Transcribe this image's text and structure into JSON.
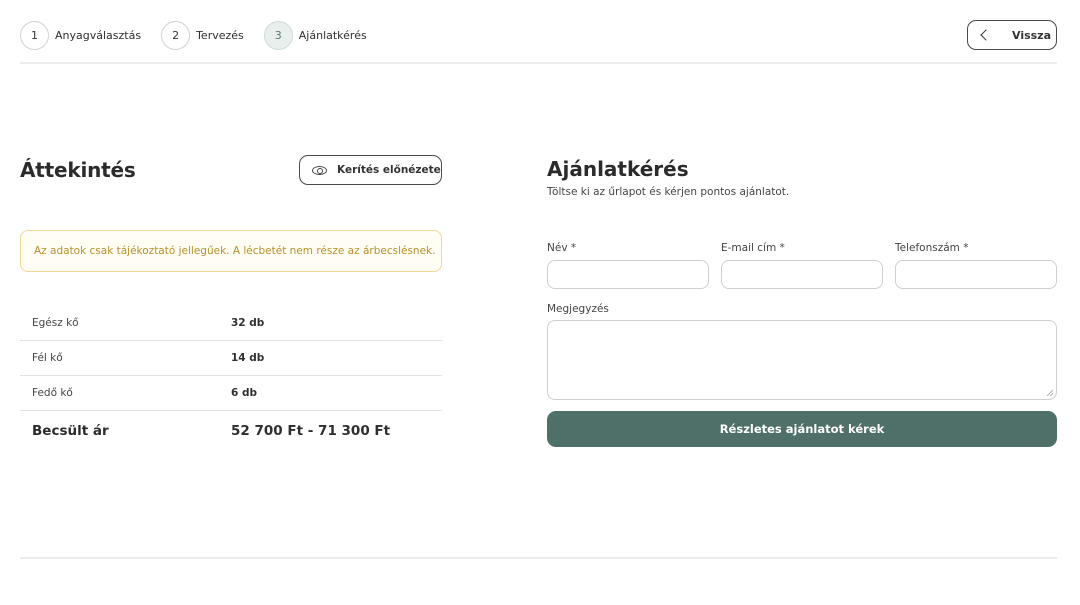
{
  "steps": [
    {
      "number": "1",
      "label": "Anyagválasztás"
    },
    {
      "number": "2",
      "label": "Tervezés"
    },
    {
      "number": "3",
      "label": "Ajánlatkérés"
    }
  ],
  "header": {
    "back_label": "Vissza"
  },
  "overview": {
    "title": "Áttekintés",
    "preview_label": "Kerítés előnézete",
    "notice": "Az adatok csak tájékoztató jellegűek. A lécbetét nem része az árbecslésnek.",
    "rows": [
      {
        "label": "Egész kő",
        "value": "32 db"
      },
      {
        "label": "Fél kő",
        "value": "14 db"
      },
      {
        "label": "Fedő kő",
        "value": "6 db"
      }
    ],
    "total": {
      "label": "Becsült ár",
      "value": "52 700 Ft - 71 300 Ft"
    }
  },
  "quote": {
    "title": "Ajánlatkérés",
    "subtitle": "Töltse ki az űrlapot és kérjen pontos ajánlatot.",
    "fields": {
      "name": {
        "label": "Név *",
        "value": ""
      },
      "email": {
        "label": "E-mail cím *",
        "value": ""
      },
      "phone": {
        "label": "Telefonszám *",
        "value": ""
      },
      "note": {
        "label": "Megjegyzés",
        "value": ""
      }
    },
    "submit_label": "Részletes ajánlatot kérek"
  },
  "colors": {
    "accent": "#4e7069",
    "notice_border": "#f0d996",
    "notice_text": "#b7902a"
  },
  "icons": {
    "back": "chevron-left-icon",
    "preview": "eye-icon"
  }
}
